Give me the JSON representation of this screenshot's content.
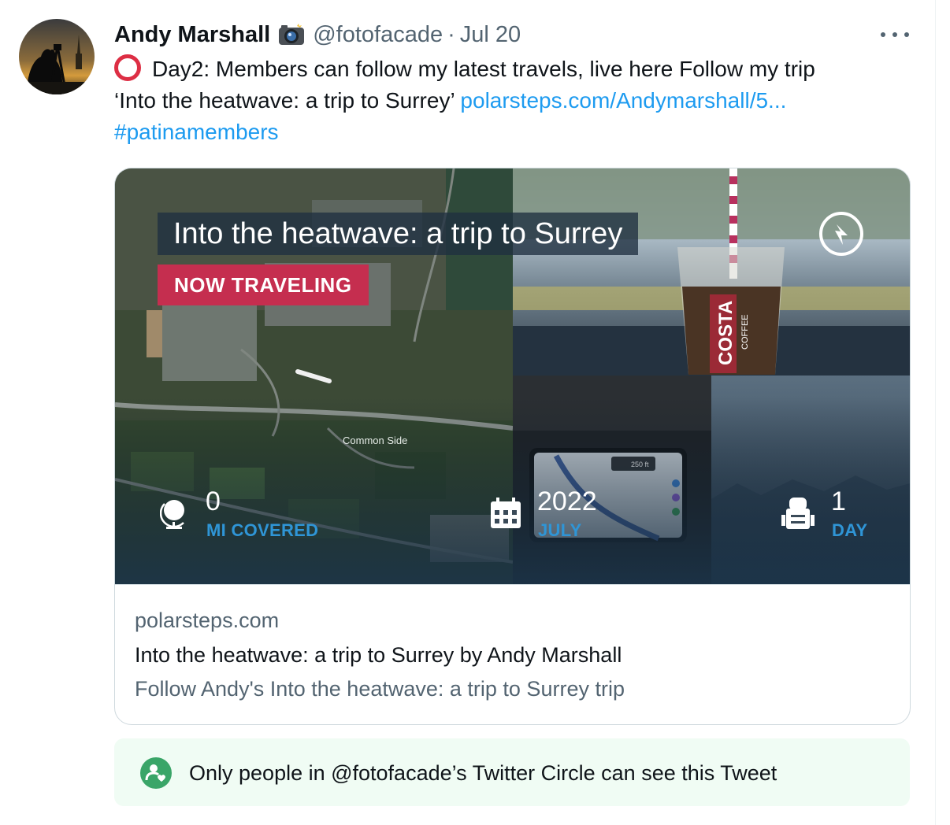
{
  "tweet": {
    "author_name": "Andy Marshall",
    "handle": "@fotofacade",
    "separator": "·",
    "date": "Jul 20",
    "text_line1": "Day2: Members can follow my latest travels, live here Follow my trip",
    "text_line2_plain": "‘Into the heatwave: a trip to Surrey’",
    "text_line2_link": "polarsteps.com/Andymarshall/5...",
    "hashtag": "#patinamembers"
  },
  "card": {
    "overlay_title": "Into the heatwave: a trip to Surrey",
    "badge": "NOW TRAVELING",
    "map_place_label": "Common Side",
    "nav_distance_label": "250 ft",
    "stats": [
      {
        "value": "0",
        "label": "MI COVERED",
        "icon": "globe-icon"
      },
      {
        "value": "2022",
        "label": "JULY",
        "icon": "calendar-icon"
      },
      {
        "value": "1",
        "label": "DAY",
        "icon": "backpack-icon"
      }
    ],
    "cup_brand": "COSTA",
    "cup_sub": "COFFEE",
    "domain": "polarsteps.com",
    "title": "Into the heatwave: a trip to Surrey by Andy Marshall",
    "description": "Follow Andy's Into the heatwave: a trip to Surrey trip"
  },
  "circle_notice": {
    "text": "Only people in @fotofacade’s Twitter Circle can see this Tweet"
  },
  "colors": {
    "link": "#1d9bf0",
    "badge": "#c52e4f",
    "stat_label": "#2f95d6",
    "circle_bg": "#f0fcf4",
    "circle_icon": "#3aa568",
    "ring": "#dd2e44"
  }
}
